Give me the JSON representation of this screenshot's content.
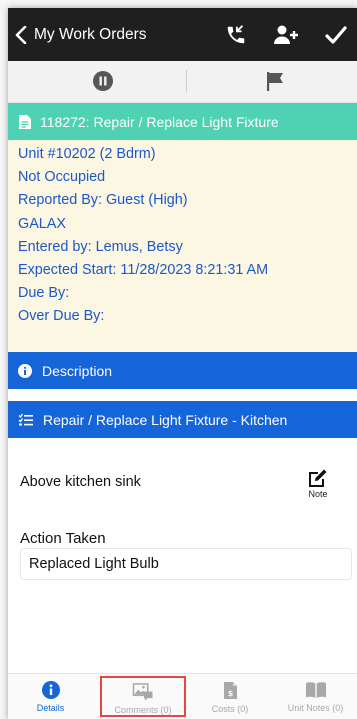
{
  "topbar": {
    "back_label": "My Work Orders",
    "icons": [
      "back-chevron-icon",
      "phone-callback-icon",
      "add-user-icon",
      "checkmark-icon"
    ]
  },
  "actionbar": {
    "icons": [
      "pause-icon",
      "flag-icon"
    ]
  },
  "work_order": {
    "title": "118272: Repair / Replace Light Fixture",
    "header_color": "#4fd1b3",
    "details": [
      "Unit #10202 (2 Bdrm)",
      "Not Occupied",
      "Reported By: Guest  (High)",
      "GALAX",
      "Entered by: Lemus, Betsy",
      "Expected Start: 11/28/2023 8:21:31 AM",
      "Due By:",
      "Over Due By:"
    ]
  },
  "description_bar": {
    "label": "Description"
  },
  "task_bar": {
    "label": "Repair / Replace Light Fixture - Kitchen"
  },
  "task": {
    "text": "Above kitchen sink",
    "note_label": "Note",
    "action_label": "Action Taken",
    "action_value": "Replaced Light Bulb"
  },
  "tabs": [
    {
      "label": "Details",
      "active": true,
      "icon": "info-icon"
    },
    {
      "label": "Comments (0)",
      "active": false,
      "icon": "image-comment-icon"
    },
    {
      "label": "Costs (0)",
      "active": false,
      "icon": "invoice-dollar-icon"
    },
    {
      "label": "Unit Notes (0)",
      "active": false,
      "icon": "open-book-icon"
    }
  ],
  "colors": {
    "topbar": "#1f1f1f",
    "accent_blue": "#1565d8",
    "details_bg": "#fcf7e3",
    "details_text": "#1b58c8",
    "highlight_box": "#e84545"
  }
}
